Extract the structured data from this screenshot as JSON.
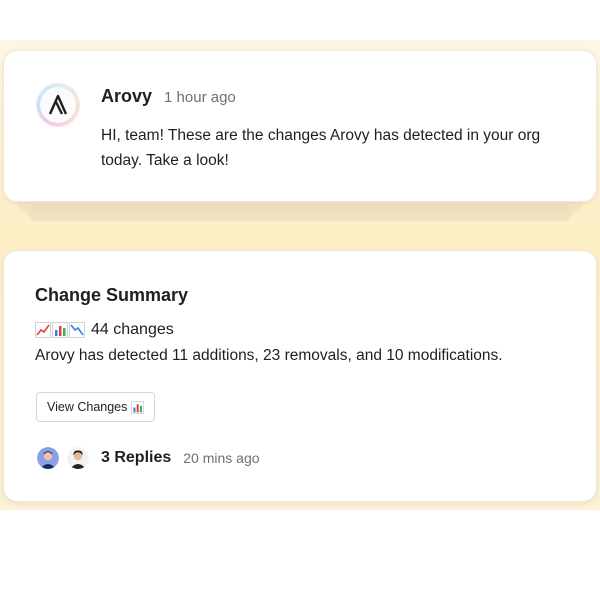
{
  "message": {
    "sender": "Arovy",
    "time": "1 hour ago",
    "text": "HI, team! These are the changes Arovy has detected in your org today. Take a look!"
  },
  "summary": {
    "title": "Change Summary",
    "count_text": "44 changes",
    "description": "Arovy has detected 11 additions, 23 removals, and 10 modifications.",
    "button_label": "View Changes",
    "icons": [
      "chart-increasing-icon",
      "bar-chart-icon",
      "chart-decreasing-icon"
    ]
  },
  "replies": {
    "label": "3 Replies",
    "time": "20 mins ago"
  }
}
